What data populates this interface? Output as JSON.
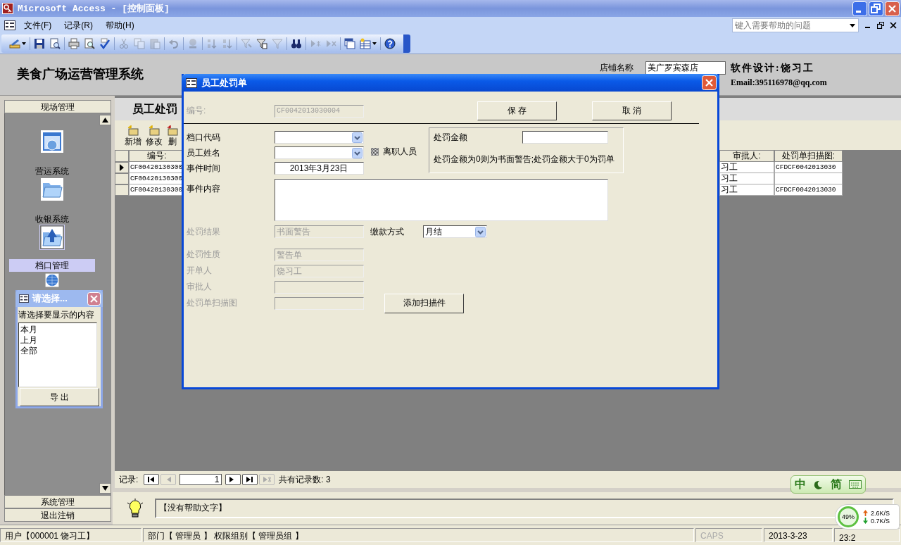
{
  "window": {
    "title": "Microsoft Access - [控制面板]"
  },
  "menu": [
    {
      "label": "文件(F)"
    },
    {
      "label": "记录(R)"
    },
    {
      "label": "帮助(H)"
    }
  ],
  "help_search": {
    "placeholder": "键入需要帮助的问题"
  },
  "toolbar": [
    {
      "disabled": false
    },
    {
      "disabled": false
    },
    {
      "disabled": false
    },
    {
      "disabled": false
    },
    {
      "disabled": false
    },
    {
      "disabled": false
    },
    {
      "disabled": true
    },
    {
      "disabled": true
    },
    {
      "disabled": true
    },
    {
      "disabled": true
    },
    {
      "disabled": true
    },
    {
      "disabled": true
    },
    {
      "disabled": true
    },
    {
      "disabled": true
    },
    {
      "disabled": false
    },
    {
      "disabled": true
    },
    {
      "disabled": false
    },
    {
      "disabled": true
    },
    {
      "disabled": true
    },
    {
      "disabled": false
    },
    {
      "disabled": false
    },
    {
      "disabled": false
    }
  ],
  "header": {
    "title": "美食广场运营管理系统",
    "store_label": "店铺名称",
    "store_name": "美广罗宾森店",
    "credit": "软件设计:饶习工",
    "email": "Email:395116978@qq.com"
  },
  "sidebar": {
    "header": "现场管理",
    "items": [
      {
        "label": "营运系统",
        "selected": false
      },
      {
        "label": "收银系统",
        "selected": false
      },
      {
        "label": "档口管理",
        "selected": true
      },
      {
        "selected": false
      }
    ],
    "buttons": [
      "系统管理",
      "退出注销"
    ]
  },
  "subform": {
    "title": "员工处罚",
    "actions": [
      "新增",
      "修改",
      "删"
    ],
    "table": {
      "columns": [
        "编号:",
        "审批人:",
        "处罚单扫描图:"
      ],
      "rows": [
        {
          "current": true,
          "id": "CF00420130300",
          "approver": "习工",
          "scan": "CFDCF0042013030"
        },
        {
          "current": false,
          "id": "CF00420130300",
          "approver": "习工"
        },
        {
          "current": false,
          "id": "CF00420130300",
          "approver": "习工",
          "scan": "CFDCF0042013030"
        }
      ]
    }
  },
  "record_nav": {
    "label": "记录:",
    "buttons_before": [
      {
        "disabled": false
      },
      {
        "disabled": true
      }
    ],
    "current": "1",
    "buttons_after": [
      {
        "disabled": false
      },
      {
        "disabled": false
      },
      {
        "disabled": true
      }
    ],
    "total": "共有记录数: 3"
  },
  "help_text": "【没有帮助文字】",
  "status_bar": {
    "user": "用户【000001 饶习工】",
    "role": "部门【 管理员 】 权限组别【 管理员组 】",
    "caps": {
      "label": "CAPS",
      "on": false
    },
    "date": "2013-3-23",
    "time": "23:2"
  },
  "dialog": {
    "title": "员工处罚单",
    "id": {
      "label": "编号:",
      "value": "CF0042013030004",
      "disabled": true
    },
    "buttons": [
      "保 存",
      "取 消"
    ],
    "fields": [
      {
        "label": "档口代码",
        "kind": "combo"
      },
      {
        "label": "员工姓名",
        "kind": "combo"
      },
      {
        "label": "事件时间",
        "kind": "text",
        "value": "2013年3月23日"
      }
    ],
    "resigned": {
      "label": "离职人员",
      "indeterminate": true
    },
    "fine": {
      "label": "处罚金额",
      "note": "处罚金额为0则为书面警告;处罚金额大于0为罚单"
    },
    "content_label": "事件内容",
    "result": {
      "label": "处罚结果",
      "value": "书面警告",
      "disabled": true
    },
    "payment": {
      "label": "缴款方式",
      "value": "月结"
    },
    "lower_fields": [
      {
        "label": "处罚性质",
        "value": "警告单",
        "disabled": true
      },
      {
        "label": "开单人",
        "value": "饶习工",
        "disabled": true
      },
      {
        "label": "审批人",
        "disabled": true
      },
      {
        "label": "处罚单扫描图",
        "disabled": true
      }
    ],
    "scan_button": "添加扫描件"
  },
  "chooser": {
    "title": "请选择...",
    "prompt": "请选择要显示的内容",
    "options": [
      {
        "label": "本月",
        "selected": false
      },
      {
        "label": "上月",
        "selected": false
      },
      {
        "label": "全部",
        "selected": false
      }
    ],
    "button": "导 出"
  },
  "ime": {
    "mode": "中",
    "script": "简"
  },
  "net_monitor": {
    "load": "49%",
    "up": "2.6K/S",
    "down": "0.7K/S"
  }
}
